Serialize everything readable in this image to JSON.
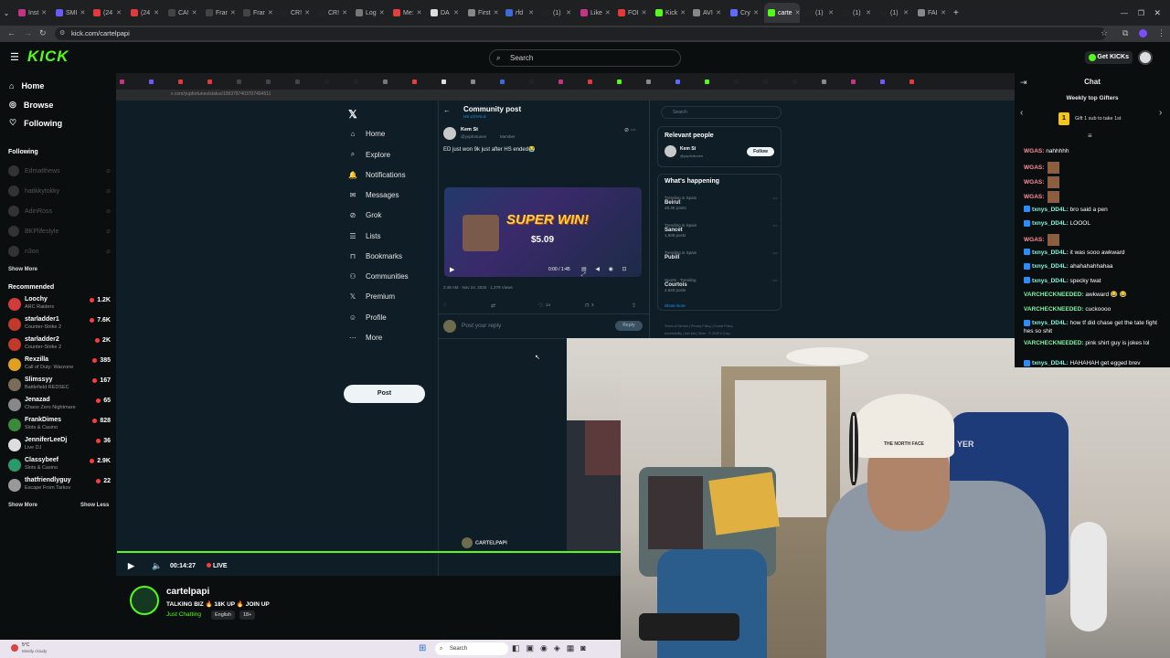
{
  "browser": {
    "tabs": [
      {
        "label": "Inst",
        "color": "#c13584"
      },
      {
        "label": "SMI",
        "color": "#6b5bff"
      },
      {
        "label": "(24",
        "color": "#e03b3b"
      },
      {
        "label": "(24",
        "color": "#e03b3b"
      },
      {
        "label": "CA!",
        "color": "#444"
      },
      {
        "label": "Frar",
        "color": "#444"
      },
      {
        "label": "Frar",
        "color": "#444"
      },
      {
        "label": "CR!",
        "color": "#222"
      },
      {
        "label": "CR!",
        "color": "#222"
      },
      {
        "label": "Log",
        "color": "#777"
      },
      {
        "label": "Me:",
        "color": "#e04040"
      },
      {
        "label": "DA",
        "color": "#ddd"
      },
      {
        "label": "First",
        "color": "#888"
      },
      {
        "label": "rfd",
        "color": "#3b6bd8"
      },
      {
        "label": "(1)",
        "color": "#222"
      },
      {
        "label": "Like",
        "color": "#c13584"
      },
      {
        "label": "FOI",
        "color": "#e03b3b"
      },
      {
        "label": "Kick",
        "color": "#53fc18"
      },
      {
        "label": "AVI",
        "color": "#888"
      },
      {
        "label": "Cry",
        "color": "#5b6bff"
      },
      {
        "label": "carte",
        "color": "#53fc18"
      },
      {
        "label": "(1)",
        "color": "#222"
      },
      {
        "label": "(1)",
        "color": "#222"
      },
      {
        "label": "(1)",
        "color": "#222"
      },
      {
        "label": "FAI",
        "color": "#888"
      }
    ],
    "active_tab": "carte",
    "url": "kick.com/cartelpapi"
  },
  "kick": {
    "logo": "KICK",
    "search_placeholder": "Search",
    "get_kicks": "Get KICKs"
  },
  "sidebar": {
    "nav": [
      "Home",
      "Browse",
      "Following"
    ],
    "following_title": "Following",
    "following": [
      "Edmatthews",
      "hatikkytokky",
      "AdinRoss",
      "BKPlifestyle",
      "n3on"
    ],
    "show_more": "Show More",
    "recommended_title": "Recommended",
    "recommended": [
      {
        "name": "Loochy",
        "game": "ARC Raiders",
        "viewers": "1.2K",
        "color": "#d23b3b"
      },
      {
        "name": "starladder1",
        "game": "Counter-Strike 2",
        "viewers": "7.6K",
        "color": "#c0392b"
      },
      {
        "name": "starladder2",
        "game": "Counter-Strike 2",
        "viewers": "2K",
        "color": "#c0392b"
      },
      {
        "name": "Rexzilla",
        "game": "Call of Duty: Warzone",
        "viewers": "385",
        "color": "#e0a020"
      },
      {
        "name": "Slimssyy",
        "game": "Battlefield REDSEC",
        "viewers": "167",
        "color": "#7a6b5b"
      },
      {
        "name": "Jenazad",
        "game": "Chaos Zero Nightmare",
        "viewers": "65",
        "color": "#888"
      },
      {
        "name": "FrankDimes",
        "game": "Slots & Casino",
        "viewers": "828",
        "color": "#3a8a3a"
      },
      {
        "name": "JenniferLeeDj",
        "game": "Live DJ",
        "viewers": "36",
        "color": "#ddd"
      },
      {
        "name": "Classybeef",
        "game": "Slots & Casino",
        "viewers": "2.9K",
        "color": "#2a9a6a"
      },
      {
        "name": "thatfriendlyguy",
        "game": "Escape From Tarkov",
        "viewers": "22",
        "color": "#999"
      }
    ],
    "show_more2": "Show More",
    "show_less": "Show Less"
  },
  "stream_screen": {
    "inner_url": "x.com/yupfortunes/status/1993787403707494511",
    "x_nav": [
      "Home",
      "Explore",
      "Notifications",
      "Messages",
      "Grok",
      "Lists",
      "Bookmarks",
      "Communities",
      "Premium",
      "Profile",
      "More"
    ],
    "post_button": "Post",
    "header": "Community post",
    "header_sub": "HS LOYALS",
    "author": "Kem St",
    "handle": "@yupfortunes",
    "role": "Member",
    "tweet_text": "ED just won 9k just after HS ended😭",
    "video_caption": "SUPER WIN!",
    "video_amount": "$5.09",
    "video_time": "0:00 / 1:45",
    "meta": "2:48 AM · Nov 24, 2025 · 1,379 Views",
    "likes": "14",
    "bookmarks": "3",
    "reply_placeholder": "Post your reply",
    "reply_button": "Reply",
    "search_placeholder": "Search",
    "relevant_title": "Relevant people",
    "rel_name": "Kem St",
    "rel_handle": "@yupfortunes",
    "follow_button": "Follow",
    "happening_title": "What's happening",
    "trends": [
      {
        "meta": "Trending in Spain",
        "name": "Beirut",
        "posts": "48.3K posts"
      },
      {
        "meta": "Trending in Spain",
        "name": "Sancet",
        "posts": "1,609 posts"
      },
      {
        "meta": "Trending in Spain",
        "name": "Pubill",
        "posts": ""
      },
      {
        "meta": "Sports · Trending",
        "name": "Courtois",
        "posts": "4,640 posts"
      }
    ],
    "show_more": "Show more",
    "footer": "Terms of Service | Privacy Policy | Cookie Policy",
    "footer2": "Accessibility | Ads info | More · © 2025 X Corp.",
    "profile_name": "CARTELPAPI",
    "hoodie": "THE NORTH FACE",
    "chair": "YER"
  },
  "player": {
    "time": "00:14:27",
    "live": "LIVE"
  },
  "stream": {
    "name": "cartelpapi",
    "title": "TALKING BIZ 🔥 18K UP 🔥 JOIN UP",
    "category": "Just Chatting",
    "tags": [
      "English",
      "18+"
    ]
  },
  "taskbar": {
    "weather_temp": "5°C",
    "weather_desc": "Mostly cloudy",
    "search": "Search"
  },
  "chat": {
    "title": "Chat",
    "gifters_title": "Weekly top Gifters",
    "gifter_rank": "1",
    "gifter_text": "Gift 1 sub to take 1st",
    "messages": [
      {
        "user": "WGAS:",
        "text": "nahhhhh",
        "color": "#ff8c9e",
        "badge": false,
        "emote": false
      },
      {
        "user": "WGAS:",
        "text": "",
        "color": "#ff8c9e",
        "badge": false,
        "emote": true
      },
      {
        "user": "WGAS:",
        "text": "",
        "color": "#ff8c9e",
        "badge": false,
        "emote": true
      },
      {
        "user": "WGAS:",
        "text": "",
        "color": "#ff8c9e",
        "badge": false,
        "emote": true
      },
      {
        "user": "txnys_DD4L:",
        "text": "bro said a pen",
        "color": "#7ff5e0",
        "badge": true,
        "emote": false
      },
      {
        "user": "txnys_DD4L:",
        "text": "LOOOL",
        "color": "#7ff5e0",
        "badge": true,
        "emote": false
      },
      {
        "user": "WGAS:",
        "text": "",
        "color": "#ff8c9e",
        "badge": false,
        "emote": true
      },
      {
        "user": "txnys_DD4L:",
        "text": "it was sooo awkward",
        "color": "#7ff5e0",
        "badge": true,
        "emote": false
      },
      {
        "user": "txnys_DD4L:",
        "text": "ahahahahhahaa",
        "color": "#7ff5e0",
        "badge": true,
        "emote": false
      },
      {
        "user": "txnys_DD4L:",
        "text": "specky twat",
        "color": "#7ff5e0",
        "badge": true,
        "emote": false
      },
      {
        "user": "VARCHECKNEEDED:",
        "text": "awkward 😂 😂",
        "color": "#7ff5a8",
        "badge": false,
        "emote": false
      },
      {
        "user": "VARCHECKNEEDED:",
        "text": "cuckoooo",
        "color": "#7ff5a8",
        "badge": false,
        "emote": false
      },
      {
        "user": "txnys_DD4L:",
        "text": "how tf did chase get the tate fight hes so shit",
        "color": "#7ff5e0",
        "badge": true,
        "emote": false
      },
      {
        "user": "VARCHECKNEEDED:",
        "text": "pink shirt guy is jokes lol",
        "color": "#7ff5a8",
        "badge": false,
        "emote": false
      },
      {
        "user": "txnys_DD4L:",
        "text": "HAHAHAH get egged brev",
        "color": "#7ff5e0",
        "badge": true,
        "emote": false
      }
    ]
  }
}
